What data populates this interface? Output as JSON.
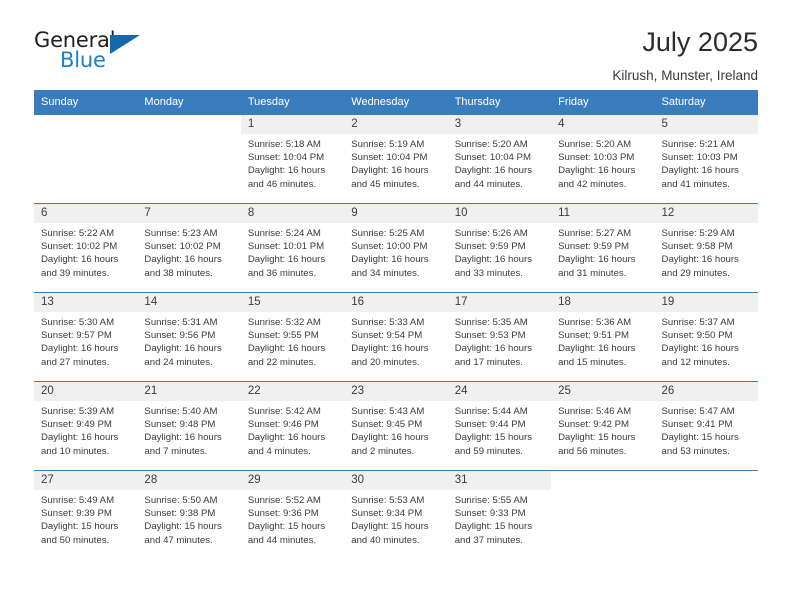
{
  "brand": {
    "name_top": "General",
    "name_bottom": "Blue",
    "triangle_color": "#1668ad",
    "text_color": "#231f20",
    "blue_color": "#1f7fc4"
  },
  "header": {
    "title": "July 2025",
    "subtitle": "Kilrush, Munster, Ireland"
  },
  "theme": {
    "header_bg": "#3a7dbf",
    "header_text": "#ffffff",
    "daynum_bg": "#f0f0f0",
    "row_border": "#3a7dbf",
    "body_text": "#3b3b3b"
  },
  "weekdays": [
    "Sunday",
    "Monday",
    "Tuesday",
    "Wednesday",
    "Thursday",
    "Friday",
    "Saturday"
  ],
  "labels": {
    "sunrise_prefix": "Sunrise:",
    "sunset_prefix": "Sunset:",
    "daylight_prefix": "Daylight:"
  },
  "weeks": [
    [
      null,
      null,
      {
        "day": "1",
        "sunrise": "Sunrise: 5:18 AM",
        "sunset": "Sunset: 10:04 PM",
        "daylight_1": "Daylight: 16 hours",
        "daylight_2": "and 46 minutes."
      },
      {
        "day": "2",
        "sunrise": "Sunrise: 5:19 AM",
        "sunset": "Sunset: 10:04 PM",
        "daylight_1": "Daylight: 16 hours",
        "daylight_2": "and 45 minutes."
      },
      {
        "day": "3",
        "sunrise": "Sunrise: 5:20 AM",
        "sunset": "Sunset: 10:04 PM",
        "daylight_1": "Daylight: 16 hours",
        "daylight_2": "and 44 minutes."
      },
      {
        "day": "4",
        "sunrise": "Sunrise: 5:20 AM",
        "sunset": "Sunset: 10:03 PM",
        "daylight_1": "Daylight: 16 hours",
        "daylight_2": "and 42 minutes."
      },
      {
        "day": "5",
        "sunrise": "Sunrise: 5:21 AM",
        "sunset": "Sunset: 10:03 PM",
        "daylight_1": "Daylight: 16 hours",
        "daylight_2": "and 41 minutes."
      }
    ],
    [
      {
        "day": "6",
        "sunrise": "Sunrise: 5:22 AM",
        "sunset": "Sunset: 10:02 PM",
        "daylight_1": "Daylight: 16 hours",
        "daylight_2": "and 39 minutes."
      },
      {
        "day": "7",
        "sunrise": "Sunrise: 5:23 AM",
        "sunset": "Sunset: 10:02 PM",
        "daylight_1": "Daylight: 16 hours",
        "daylight_2": "and 38 minutes."
      },
      {
        "day": "8",
        "sunrise": "Sunrise: 5:24 AM",
        "sunset": "Sunset: 10:01 PM",
        "daylight_1": "Daylight: 16 hours",
        "daylight_2": "and 36 minutes."
      },
      {
        "day": "9",
        "sunrise": "Sunrise: 5:25 AM",
        "sunset": "Sunset: 10:00 PM",
        "daylight_1": "Daylight: 16 hours",
        "daylight_2": "and 34 minutes."
      },
      {
        "day": "10",
        "sunrise": "Sunrise: 5:26 AM",
        "sunset": "Sunset: 9:59 PM",
        "daylight_1": "Daylight: 16 hours",
        "daylight_2": "and 33 minutes."
      },
      {
        "day": "11",
        "sunrise": "Sunrise: 5:27 AM",
        "sunset": "Sunset: 9:59 PM",
        "daylight_1": "Daylight: 16 hours",
        "daylight_2": "and 31 minutes."
      },
      {
        "day": "12",
        "sunrise": "Sunrise: 5:29 AM",
        "sunset": "Sunset: 9:58 PM",
        "daylight_1": "Daylight: 16 hours",
        "daylight_2": "and 29 minutes."
      }
    ],
    [
      {
        "day": "13",
        "sunrise": "Sunrise: 5:30 AM",
        "sunset": "Sunset: 9:57 PM",
        "daylight_1": "Daylight: 16 hours",
        "daylight_2": "and 27 minutes."
      },
      {
        "day": "14",
        "sunrise": "Sunrise: 5:31 AM",
        "sunset": "Sunset: 9:56 PM",
        "daylight_1": "Daylight: 16 hours",
        "daylight_2": "and 24 minutes."
      },
      {
        "day": "15",
        "sunrise": "Sunrise: 5:32 AM",
        "sunset": "Sunset: 9:55 PM",
        "daylight_1": "Daylight: 16 hours",
        "daylight_2": "and 22 minutes."
      },
      {
        "day": "16",
        "sunrise": "Sunrise: 5:33 AM",
        "sunset": "Sunset: 9:54 PM",
        "daylight_1": "Daylight: 16 hours",
        "daylight_2": "and 20 minutes."
      },
      {
        "day": "17",
        "sunrise": "Sunrise: 5:35 AM",
        "sunset": "Sunset: 9:53 PM",
        "daylight_1": "Daylight: 16 hours",
        "daylight_2": "and 17 minutes."
      },
      {
        "day": "18",
        "sunrise": "Sunrise: 5:36 AM",
        "sunset": "Sunset: 9:51 PM",
        "daylight_1": "Daylight: 16 hours",
        "daylight_2": "and 15 minutes."
      },
      {
        "day": "19",
        "sunrise": "Sunrise: 5:37 AM",
        "sunset": "Sunset: 9:50 PM",
        "daylight_1": "Daylight: 16 hours",
        "daylight_2": "and 12 minutes."
      }
    ],
    [
      {
        "day": "20",
        "sunrise": "Sunrise: 5:39 AM",
        "sunset": "Sunset: 9:49 PM",
        "daylight_1": "Daylight: 16 hours",
        "daylight_2": "and 10 minutes."
      },
      {
        "day": "21",
        "sunrise": "Sunrise: 5:40 AM",
        "sunset": "Sunset: 9:48 PM",
        "daylight_1": "Daylight: 16 hours",
        "daylight_2": "and 7 minutes."
      },
      {
        "day": "22",
        "sunrise": "Sunrise: 5:42 AM",
        "sunset": "Sunset: 9:46 PM",
        "daylight_1": "Daylight: 16 hours",
        "daylight_2": "and 4 minutes."
      },
      {
        "day": "23",
        "sunrise": "Sunrise: 5:43 AM",
        "sunset": "Sunset: 9:45 PM",
        "daylight_1": "Daylight: 16 hours",
        "daylight_2": "and 2 minutes."
      },
      {
        "day": "24",
        "sunrise": "Sunrise: 5:44 AM",
        "sunset": "Sunset: 9:44 PM",
        "daylight_1": "Daylight: 15 hours",
        "daylight_2": "and 59 minutes."
      },
      {
        "day": "25",
        "sunrise": "Sunrise: 5:46 AM",
        "sunset": "Sunset: 9:42 PM",
        "daylight_1": "Daylight: 15 hours",
        "daylight_2": "and 56 minutes."
      },
      {
        "day": "26",
        "sunrise": "Sunrise: 5:47 AM",
        "sunset": "Sunset: 9:41 PM",
        "daylight_1": "Daylight: 15 hours",
        "daylight_2": "and 53 minutes."
      }
    ],
    [
      {
        "day": "27",
        "sunrise": "Sunrise: 5:49 AM",
        "sunset": "Sunset: 9:39 PM",
        "daylight_1": "Daylight: 15 hours",
        "daylight_2": "and 50 minutes."
      },
      {
        "day": "28",
        "sunrise": "Sunrise: 5:50 AM",
        "sunset": "Sunset: 9:38 PM",
        "daylight_1": "Daylight: 15 hours",
        "daylight_2": "and 47 minutes."
      },
      {
        "day": "29",
        "sunrise": "Sunrise: 5:52 AM",
        "sunset": "Sunset: 9:36 PM",
        "daylight_1": "Daylight: 15 hours",
        "daylight_2": "and 44 minutes."
      },
      {
        "day": "30",
        "sunrise": "Sunrise: 5:53 AM",
        "sunset": "Sunset: 9:34 PM",
        "daylight_1": "Daylight: 15 hours",
        "daylight_2": "and 40 minutes."
      },
      {
        "day": "31",
        "sunrise": "Sunrise: 5:55 AM",
        "sunset": "Sunset: 9:33 PM",
        "daylight_1": "Daylight: 15 hours",
        "daylight_2": "and 37 minutes."
      },
      null,
      null
    ]
  ]
}
